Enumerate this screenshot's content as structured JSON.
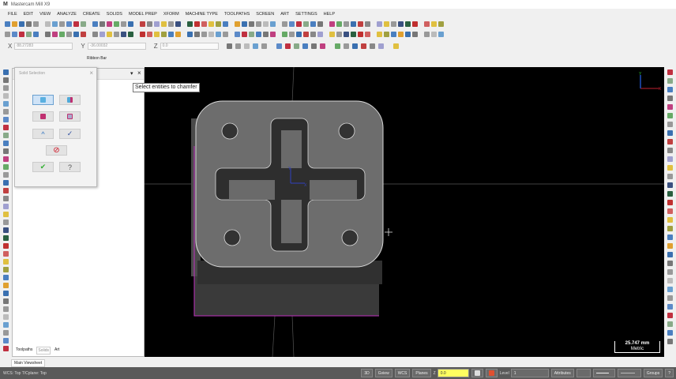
{
  "app": {
    "title": "Mastercam Mill X9"
  },
  "menu": [
    "FILE",
    "EDIT",
    "VIEW",
    "ANALYZE",
    "CREATE",
    "SOLIDS",
    "MODEL PREP",
    "XFORM",
    "MACHINE TYPE",
    "TOOLPATHS",
    "SCREEN",
    "ART",
    "SETTINGS",
    "HELP"
  ],
  "toolbar_colors": [
    "#4a7fc0",
    "#e0a030",
    "#3a70b0",
    "#777",
    "#999",
    "#bbb",
    "#6aa0d0",
    "#999",
    "#5c8ac8",
    "#c03040",
    "#8a8",
    "#4a7fc0",
    "#777",
    "#c04080",
    "#6a6",
    "#999",
    "#3a70b0",
    "#c04040",
    "#888",
    "#a0a0d0",
    "#e0c040",
    "#999",
    "#3a5080",
    "#2a6040",
    "#c03030",
    "#d06060",
    "#e0c040",
    "#a0a040"
  ],
  "coords": {
    "x_label": "X",
    "x_value": "88.27283",
    "y_label": "Y",
    "y_value": "-36.00032",
    "z_label": "Z",
    "z_value": "0.0"
  },
  "ribbon_label": "Ribbon Bar",
  "manager": {
    "tabs": [
      "Toolpaths",
      "Solids",
      "Art"
    ],
    "pin": "▾",
    "close": "×"
  },
  "dialog": {
    "title": "Solid Selection",
    "close": "×",
    "ok": "✔",
    "help": "?",
    "cancel": "⃠"
  },
  "tooltip": "Select entities to chamfer",
  "scale": {
    "value": "25.747 mm",
    "units": "Metric"
  },
  "viewsheet_tab": "Main Viewsheet",
  "status": {
    "left": "WCS: Top  T/Cplane: Top",
    "btn_3d": "3D",
    "gview": "Gview",
    "wcs": "WCS",
    "planes": "Planes",
    "z_label": "Z",
    "z_value": "0.0",
    "level_label": "Level",
    "level_value": "1",
    "attributes": "Attributes",
    "groups": "Groups",
    "help": "?"
  },
  "colors": {
    "viewport": "#000000",
    "accent_magenta": "#c030c0",
    "z_field": "#ffff60"
  }
}
